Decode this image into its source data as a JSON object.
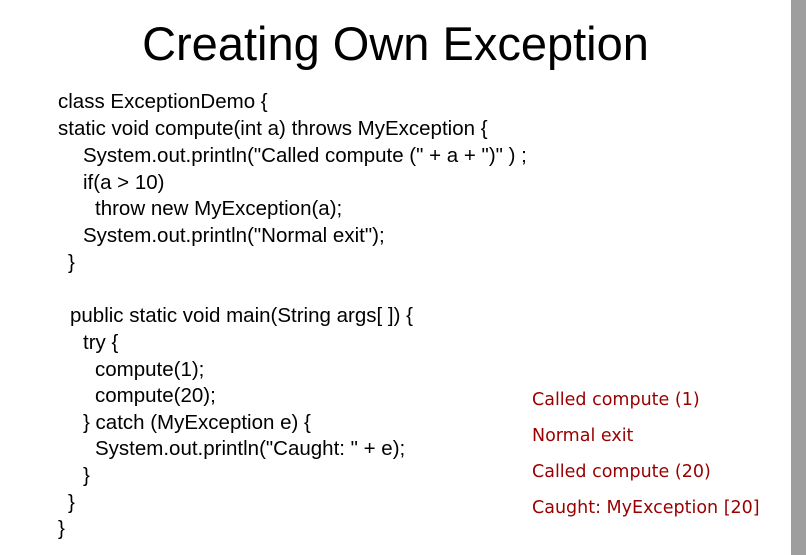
{
  "slide": {
    "title": "Creating Own Exception",
    "code_lines": [
      "class ExceptionDemo {",
      "static void compute(int a) throws MyException {",
      "System.out.println(\"Called compute (\" + a + \")\" ) ;",
      "if(a > 10)",
      "throw new MyException(a);",
      "System.out.println(\"Normal exit\");",
      "}",
      "public static void main(String args[ ]) {",
      "try {",
      "compute(1);",
      "compute(20);",
      "} catch (MyException e) {",
      "System.out.println(\"Caught: \" + e);",
      "}",
      "}",
      "}"
    ],
    "output_lines": [
      "Called compute (1)",
      "Normal exit",
      "Called compute (20)",
      "Caught: MyException [20]"
    ],
    "colors": {
      "code_text": "#000000",
      "output_text": "#990000",
      "side_bar": "#9e9e9e"
    }
  }
}
